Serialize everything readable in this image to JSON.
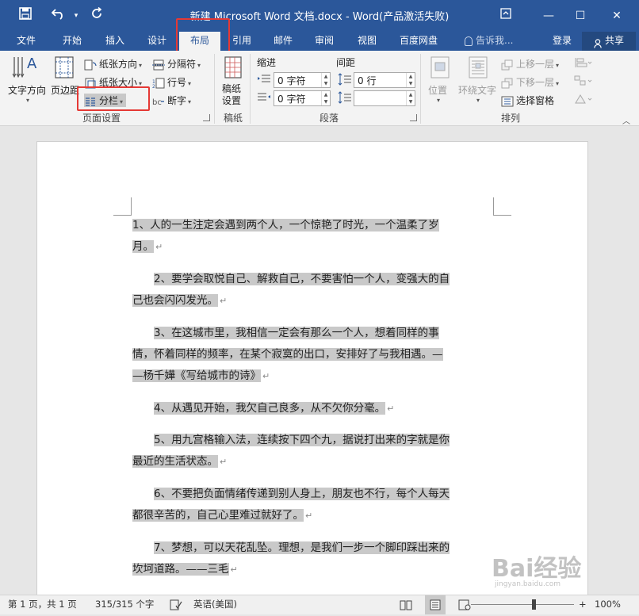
{
  "title_bar": {
    "title": "新建 Microsoft Word 文档.docx - Word(产品激活失败)",
    "save_icon": "save-icon",
    "undo_icon": "undo-icon",
    "redo_icon": "redo-icon",
    "restore_icon": "ribbon-display-icon",
    "minimize": "—",
    "maximize": "☐",
    "close": "✕"
  },
  "tabs": [
    "文件",
    "开始",
    "插入",
    "设计",
    "布局",
    "引用",
    "邮件",
    "审阅",
    "视图",
    "百度网盘"
  ],
  "active_tab": "布局",
  "tell_me": "告诉我...",
  "login": "登录",
  "share": "共享",
  "ribbon": {
    "page_setup": {
      "label": "页面设置",
      "text_direction": "文字方向",
      "margins": "页边距",
      "orientation": "纸张方向",
      "size": "纸张大小",
      "columns": "分栏",
      "breaks": "分隔符",
      "line_numbers": "行号",
      "hyphenation": "断字"
    },
    "draft": {
      "label": "稿纸",
      "draft_settings": "稿纸\n设置",
      "draft_line1": "稿纸",
      "draft_line2": "设置"
    },
    "paragraph": {
      "label": "段落",
      "indent": "缩进",
      "spacing": "间距",
      "indent_left": "0 字符",
      "indent_right": "0 字符",
      "spacing_before": "0 行",
      "spacing_after": ""
    },
    "arrange": {
      "label": "排列",
      "position": "位置",
      "wrap_text": "环绕文字",
      "bring_forward": "上移一层",
      "send_backward": "下移一层",
      "selection_pane": "选择窗格"
    }
  },
  "document": {
    "paragraphs": [
      [
        "1、人的一生注定会遇到两个人，一个惊艳了时光，一个温柔了岁",
        "月。"
      ],
      [
        "2、要学会取悦自己、解救自己，不要害怕一个人，变强大的自",
        "己也会闪闪发光。"
      ],
      [
        "3、在这城市里，我相信一定会有那么一个人，想着同样的事",
        "情，怀着同样的频率，在某个寂寞的出口，安排好了与我相遇。—",
        "—杨千嬅《写给城市的诗》"
      ],
      [
        "4、从遇见开始，我欠自己良多，从不欠你分毫。"
      ],
      [
        "5、用九宫格输入法，连续按下四个九，据说打出来的字就是你",
        "最近的生活状态。"
      ],
      [
        "6、不要把负面情绪传递到别人身上，朋友也不行，每个人每天",
        "都很辛苦的，自己心里难过就好了。"
      ],
      [
        "7、梦想，可以天花乱坠。理想，是我们一步一个脚印踩出来的",
        "坎坷道路。——三毛"
      ]
    ],
    "paragraph_mark": "↵"
  },
  "status": {
    "page": "第 1 页，共 1 页",
    "words": "315/315 个字",
    "language": "英语(美国)",
    "zoom": "100%"
  },
  "watermark": "Bai经验",
  "watermark_sub": "jingyan.baidu.com"
}
